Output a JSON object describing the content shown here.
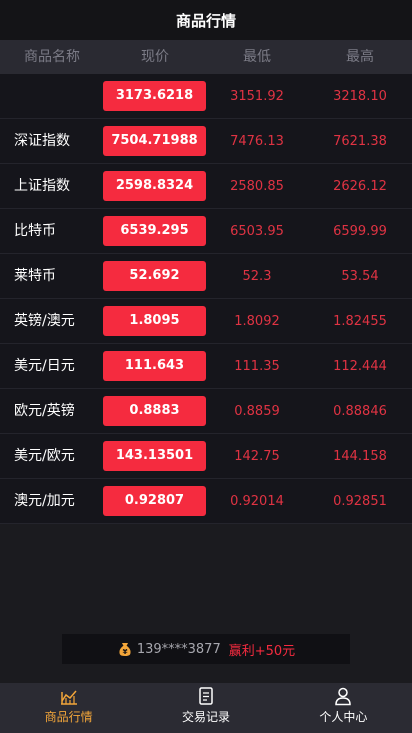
{
  "header": {
    "title": "商品行情"
  },
  "table": {
    "columns": [
      "商品名称",
      "现价",
      "最低",
      "最高"
    ],
    "rows": [
      {
        "name": "",
        "price": "3173.6218",
        "low": "3151.92",
        "high": "3218.10"
      },
      {
        "name": "深证指数",
        "price": "7504.71988",
        "low": "7476.13",
        "high": "7621.38"
      },
      {
        "name": "上证指数",
        "price": "2598.8324",
        "low": "2580.85",
        "high": "2626.12"
      },
      {
        "name": "比特币",
        "price": "6539.295",
        "low": "6503.95",
        "high": "6599.99"
      },
      {
        "name": "莱特币",
        "price": "52.692",
        "low": "52.3",
        "high": "53.54"
      },
      {
        "name": "英镑/澳元",
        "price": "1.8095",
        "low": "1.8092",
        "high": "1.82455"
      },
      {
        "name": "美元/日元",
        "price": "111.643",
        "low": "111.35",
        "high": "112.444"
      },
      {
        "name": "欧元/英镑",
        "price": "0.8883",
        "low": "0.8859",
        "high": "0.88846"
      },
      {
        "name": "美元/欧元",
        "price": "143.13501",
        "low": "142.75",
        "high": "144.158"
      },
      {
        "name": "澳元/加元",
        "price": "0.92807",
        "low": "0.92014",
        "high": "0.92851"
      }
    ]
  },
  "notice": {
    "user": "139****3877",
    "profit": "赢利+50元",
    "icon": "money-bag-icon"
  },
  "tabbar": [
    {
      "label": "商品行情",
      "icon": "market-chart-icon",
      "active": true
    },
    {
      "label": "交易记录",
      "icon": "record-list-icon",
      "active": false
    },
    {
      "label": "个人中心",
      "icon": "person-icon",
      "active": false
    }
  ],
  "colors": {
    "accent": "#f52b3f",
    "tab_active": "#f3a63a"
  }
}
